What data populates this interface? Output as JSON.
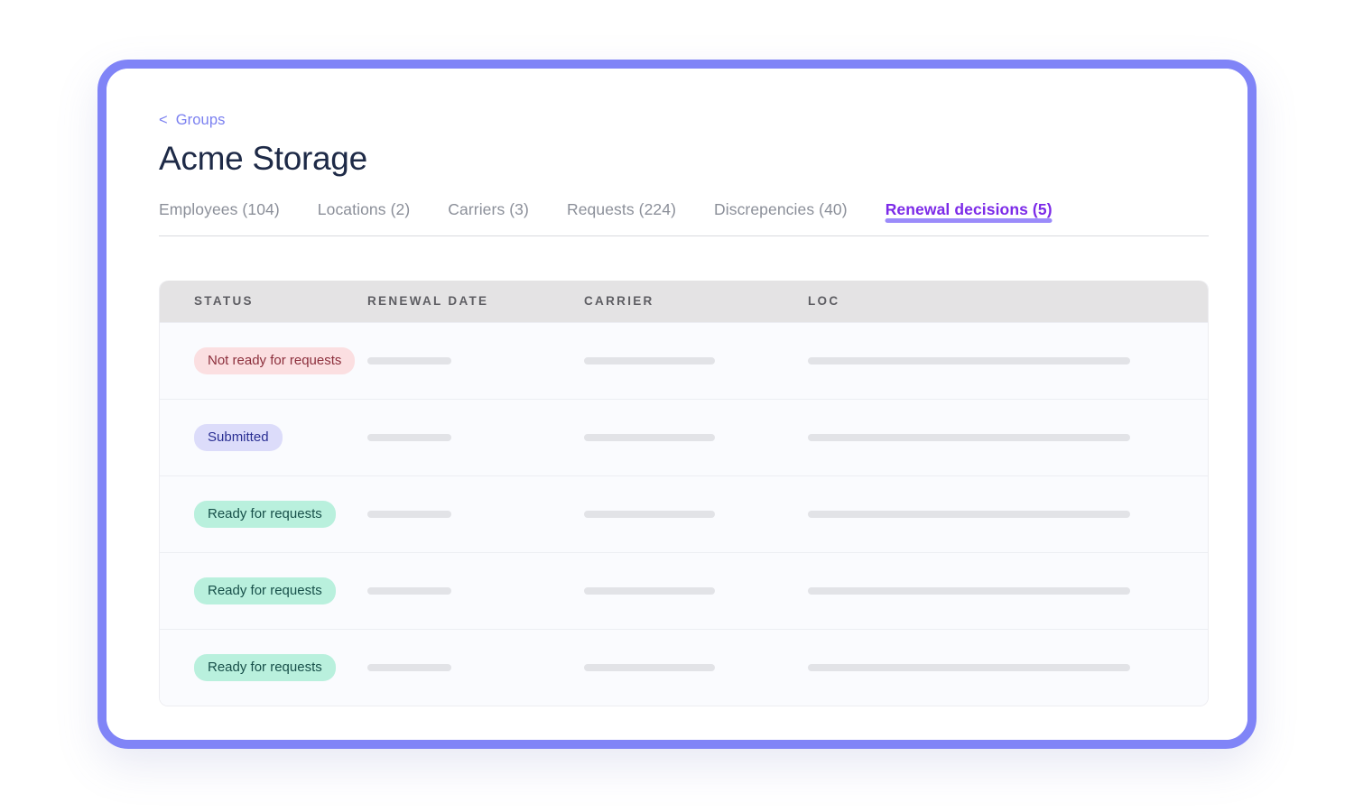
{
  "breadcrumb": {
    "chevron": "<",
    "label": "Groups"
  },
  "page_title": "Acme Storage",
  "tabs": [
    {
      "label": "Employees (104)",
      "active": false
    },
    {
      "label": "Locations (2)",
      "active": false
    },
    {
      "label": "Carriers (3)",
      "active": false
    },
    {
      "label": "Requests (224)",
      "active": false
    },
    {
      "label": "Discrepencies (40)",
      "active": false
    },
    {
      "label": "Renewal decisions (5)",
      "active": true
    }
  ],
  "table": {
    "columns": [
      "STATUS",
      "RENEWAL DATE",
      "CARRIER",
      "LOC"
    ],
    "rows": [
      {
        "status": "Not ready for requests",
        "status_kind": "danger",
        "renewal_date": "",
        "carrier": "",
        "loc": ""
      },
      {
        "status": "Submitted",
        "status_kind": "info",
        "renewal_date": "",
        "carrier": "",
        "loc": ""
      },
      {
        "status": "Ready for requests",
        "status_kind": "success",
        "renewal_date": "",
        "carrier": "",
        "loc": ""
      },
      {
        "status": "Ready for requests",
        "status_kind": "success",
        "renewal_date": "",
        "carrier": "",
        "loc": ""
      },
      {
        "status": "Ready for requests",
        "status_kind": "success",
        "renewal_date": "",
        "carrier": "",
        "loc": ""
      }
    ]
  },
  "colors": {
    "frame_border": "#8084f7",
    "breadcrumb_link": "#7b80f0",
    "title": "#1e2a47",
    "tab_inactive": "#8b8f99",
    "tab_active": "#7c2ae8",
    "tab_indicator": "#9b8bfa",
    "table_header_bg": "#e4e3e4",
    "table_header_text": "#5e5e63",
    "row_bg": "#fafbfe",
    "row_divider": "#eceef3",
    "skeleton": "#e2e3e7",
    "badge_danger_bg": "#fbdfe1",
    "badge_danger_text": "#8c2f3c",
    "badge_info_bg": "#dcdcfa",
    "badge_info_text": "#2a2f93",
    "badge_success_bg": "#b9f0dd",
    "badge_success_text": "#18504a"
  }
}
